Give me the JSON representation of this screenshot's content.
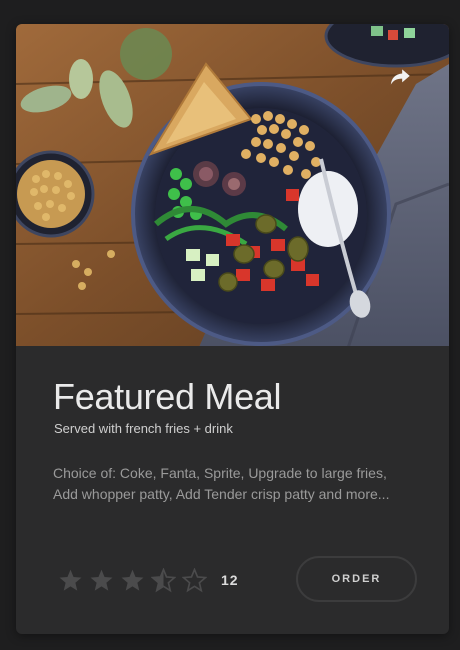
{
  "card": {
    "title": "Featured Meal",
    "subtitle": "Served with french fries + drink",
    "description": "Choice of: Coke, Fanta, Sprite, Upgrade to large fries, Add whopper patty, Add Tender crisp patty and more...",
    "rating": {
      "value": 3.5,
      "max": 5,
      "count": "12"
    },
    "order_label": "ORDER",
    "share_icon": "share-arrow-icon",
    "star_icon": "star-icon"
  },
  "colors": {
    "page_bg": "#1e1e1f",
    "card_bg": "#2b2b2c",
    "title": "#eaeaea",
    "description": "#9a9a9a",
    "star_filled": "#4b4b4c",
    "button_border": "#3c3c3d"
  }
}
